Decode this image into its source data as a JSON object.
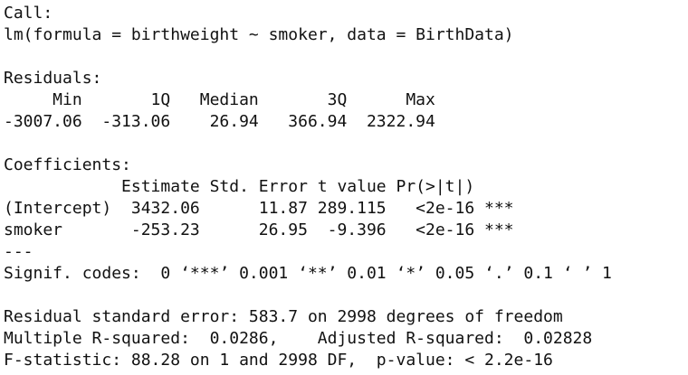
{
  "console": {
    "lines": [
      "Call:",
      "lm(formula = birthweight ~ smoker, data = BirthData)",
      "",
      "Residuals:",
      "     Min       1Q   Median       3Q      Max ",
      "-3007.06  -313.06    26.94   366.94  2322.94 ",
      "",
      "Coefficients:",
      "            Estimate Std. Error t value Pr(>|t|)    ",
      "(Intercept)  3432.06      11.87 289.115   <2e-16 ***",
      "smoker       -253.23      26.95  -9.396   <2e-16 ***",
      "---",
      "Signif. codes:  0 ‘***’ 0.001 ‘**’ 0.01 ‘*’ 0.05 ‘.’ 0.1 ‘ ’ 1",
      "",
      "Residual standard error: 583.7 on 2998 degrees of freedom",
      "Multiple R-squared:  0.0286,    Adjusted R-squared:  0.02828 ",
      "F-statistic: 88.28 on 1 and 2998 DF,  p-value: < 2.2e-16"
    ]
  }
}
